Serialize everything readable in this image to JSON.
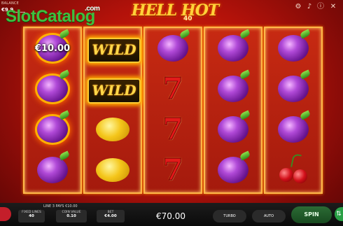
{
  "header": {
    "balance_label": "BALANCE",
    "balance_value": "€9,9__.__",
    "watermark": "SlotCatalog",
    "watermark_tld": ".com",
    "logo_title": "HELL HOT",
    "logo_subtitle": "40",
    "icons": [
      "settings-icon",
      "sound-icon",
      "info-icon",
      "close-icon"
    ]
  },
  "reels": [
    [
      {
        "symbol": "plum",
        "flame": true,
        "win_text": "€10.00"
      },
      {
        "symbol": "plum",
        "flame": true
      },
      {
        "symbol": "plum",
        "flame": true
      },
      {
        "symbol": "plum",
        "flame": false
      }
    ],
    [
      {
        "symbol": "wild",
        "text": "WILD"
      },
      {
        "symbol": "wild",
        "text": "WILD"
      },
      {
        "symbol": "lemon"
      },
      {
        "symbol": "lemon"
      }
    ],
    [
      {
        "symbol": "plum",
        "flame": false
      },
      {
        "symbol": "seven",
        "text": "7"
      },
      {
        "symbol": "seven",
        "text": "7"
      },
      {
        "symbol": "seven",
        "text": "7"
      }
    ],
    [
      {
        "symbol": "plum",
        "flame": false
      },
      {
        "symbol": "plum",
        "flame": false
      },
      {
        "symbol": "plum",
        "flame": false
      },
      {
        "symbol": "plum",
        "flame": false
      }
    ],
    [
      {
        "symbol": "plum",
        "flame": false
      },
      {
        "symbol": "plum",
        "flame": false
      },
      {
        "symbol": "plum",
        "flame": false
      },
      {
        "symbol": "cherry"
      }
    ]
  ],
  "footer": {
    "win_line_text": "LINE 3 PAYS €10.00",
    "fixed_lines_label": "FIXED LINES",
    "fixed_lines_value": "40",
    "coin_value_label": "COIN VALUE",
    "coin_value_value": "0.10",
    "bet_label": "BET",
    "bet_value": "€4.00",
    "total_win": "€70.00",
    "turbo_label": "TURBO",
    "auto_label": "AUTO",
    "spin_label": "SPIN"
  },
  "colors": {
    "background": "#c41f0d",
    "reel_border": "#ffb84a",
    "spin_button": "#2b6b34",
    "watermark": "#3fbf3f"
  }
}
